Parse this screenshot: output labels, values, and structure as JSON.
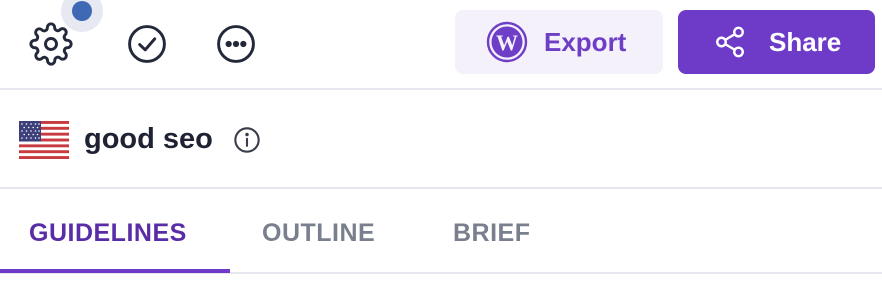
{
  "toolbar": {
    "icons": {
      "settings": "gear-icon",
      "approve": "check-circle-icon",
      "more": "more-horizontal-icon"
    },
    "notification_dot_color": "#3f69b4",
    "export_label": "Export",
    "export_icon": "wordpress-icon",
    "share_label": "Share",
    "share_icon": "share-icon"
  },
  "keyword": {
    "country_flag": "us-flag-icon",
    "text": "good seo",
    "info_icon": "info-icon"
  },
  "tabs": [
    {
      "label": "GUIDELINES",
      "active": true
    },
    {
      "label": "OUTLINE",
      "active": false
    },
    {
      "label": "BRIEF",
      "active": false
    }
  ],
  "colors": {
    "accent": "#6e3ac8",
    "accent_light": "#f4f1fa",
    "active_tab_text": "#5a2da8",
    "inactive_tab_text": "#7a7f8e",
    "divider": "#e6e6ee"
  }
}
